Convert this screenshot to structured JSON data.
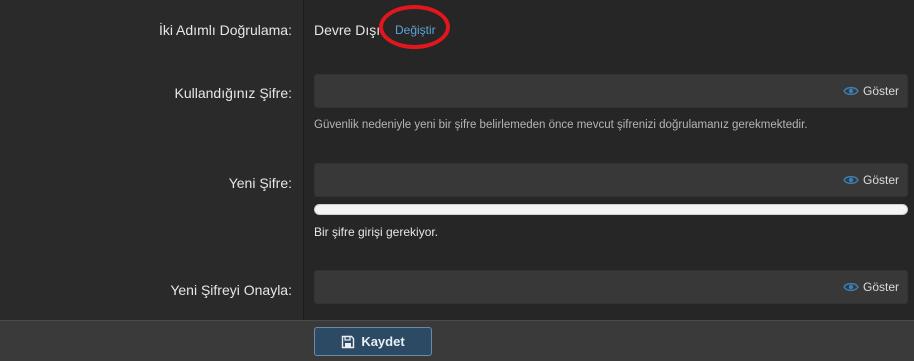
{
  "two_factor": {
    "label": "İki Adımlı Doğrulama:",
    "status": "Devre Dışı",
    "change_link": "Değiştir"
  },
  "current_password": {
    "label": "Kullandığınız Şifre:",
    "value": "",
    "show_label": "Göster",
    "help": "Güvenlik nedeniyle yeni bir şifre belirlemeden önce mevcut şifrenizi doğrulamanız gerekmektedir."
  },
  "new_password": {
    "label": "Yeni Şifre:",
    "value": "",
    "show_label": "Göster",
    "strength": 0,
    "hint": "Bir şifre girişi gerekiyor."
  },
  "confirm_password": {
    "label": "Yeni Şifreyi Onayla:",
    "value": "",
    "show_label": "Göster"
  },
  "footer": {
    "save_label": "Kaydet"
  },
  "colors": {
    "accent_link": "#5fa2d6",
    "highlight_ring": "#e3161d",
    "button_bg": "#2c4a64"
  },
  "icons": {
    "show_toggle": "eye-icon",
    "save": "floppy-disk-icon"
  }
}
